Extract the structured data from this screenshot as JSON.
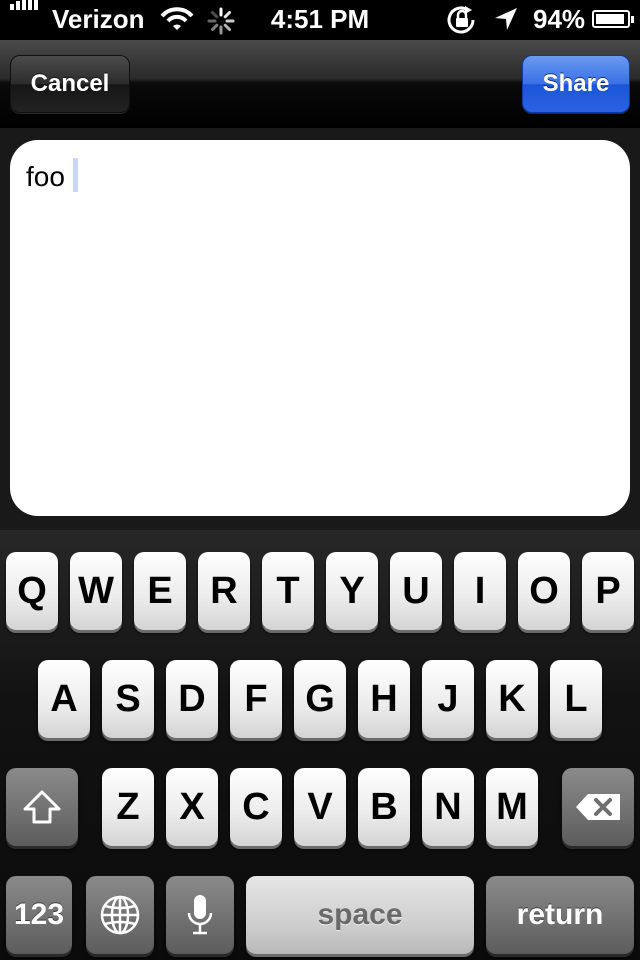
{
  "status_bar": {
    "carrier": "Verizon",
    "time": "4:51 PM",
    "battery_percent": "94%",
    "battery_level": 0.94,
    "icons": [
      "signal-bars-icon",
      "wifi-icon",
      "activity-spinner-icon",
      "rotation-lock-icon",
      "location-arrow-icon",
      "battery-icon"
    ]
  },
  "toolbar": {
    "cancel_label": "Cancel",
    "share_label": "Share",
    "share_color": "#2a62e2"
  },
  "compose": {
    "text": "foo"
  },
  "keyboard": {
    "row1": [
      "Q",
      "W",
      "E",
      "R",
      "T",
      "Y",
      "U",
      "I",
      "O",
      "P"
    ],
    "row2": [
      "A",
      "S",
      "D",
      "F",
      "G",
      "H",
      "J",
      "K",
      "L"
    ],
    "row3": [
      "Z",
      "X",
      "C",
      "V",
      "B",
      "N",
      "M"
    ],
    "numbers_label": "123",
    "space_label": "space",
    "return_label": "return",
    "special_icons": [
      "shift-icon",
      "backspace-icon",
      "globe-icon",
      "microphone-icon"
    ]
  }
}
